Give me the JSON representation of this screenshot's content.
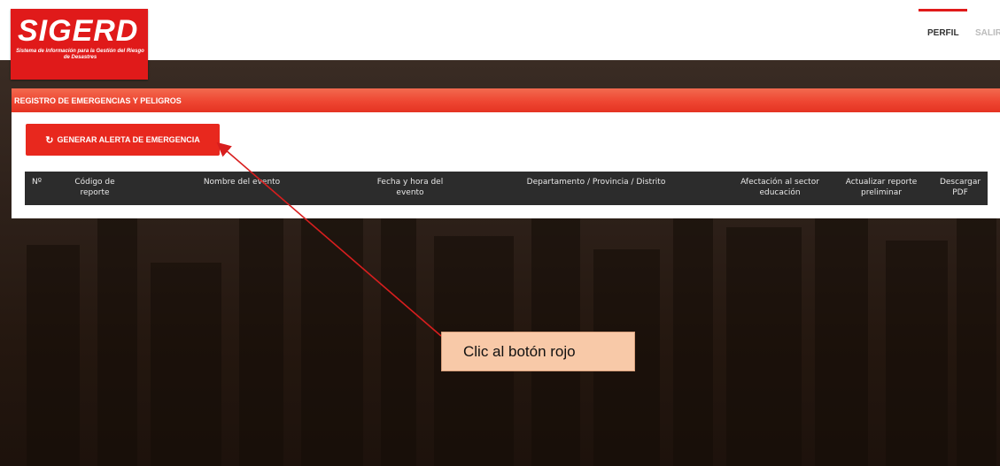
{
  "header": {
    "logo_title": "SIGERD",
    "logo_subtitle": "Sistema de información para la Gestión del Riesgo de Desastres",
    "nav": [
      {
        "label": "PERFIL",
        "active": true
      },
      {
        "label": "SALIR",
        "active": false
      }
    ]
  },
  "panel": {
    "title": "REGISTRO DE EMERGENCIAS Y PELIGROS",
    "alert_button": {
      "icon": "refresh-icon",
      "label": "GENERAR ALERTA DE EMERGENCIA"
    },
    "table_headers": [
      "Nº",
      "Código de reporte",
      "Nombre del evento",
      "Fecha y hora del evento",
      "Departamento / Provincia / Distrito",
      "Afectación al sector educación",
      "Actualizar reporte preliminar",
      "Descargar PDF"
    ]
  },
  "annotation": {
    "text": "Clic al botón rojo"
  },
  "colors": {
    "brand_red": "#e01a1a",
    "button_red": "#e8281e",
    "table_header_bg": "#2c2c2c",
    "callout_bg": "#f8c9a8"
  }
}
